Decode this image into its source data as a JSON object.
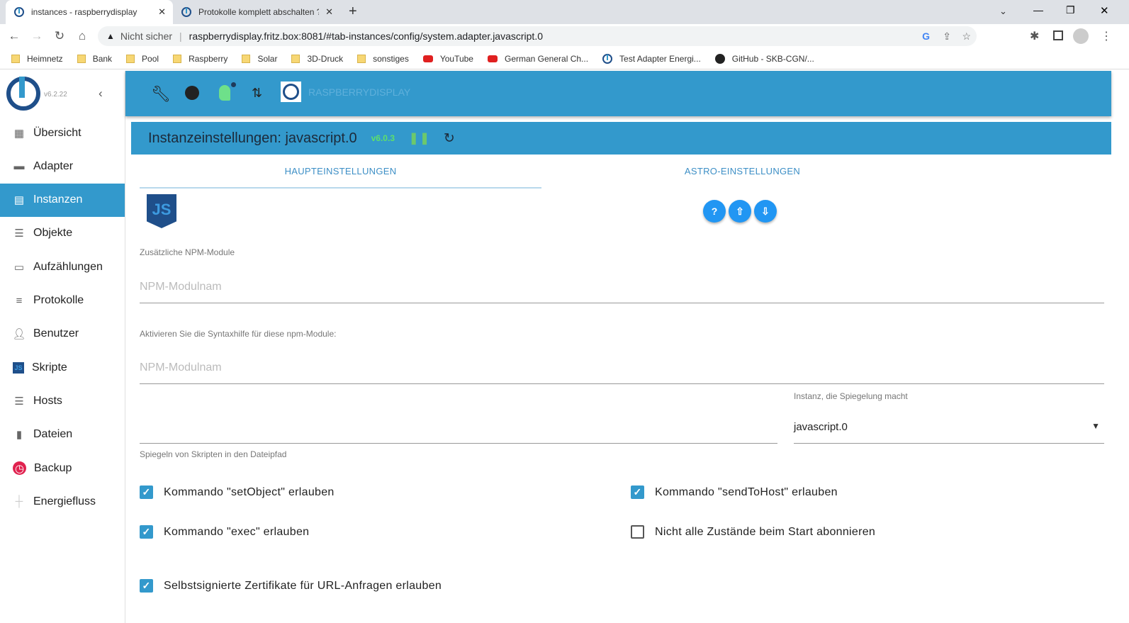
{
  "browser": {
    "tabs": [
      {
        "title": "instances - raspberrydisplay",
        "active": true
      },
      {
        "title": "Protokolle komplett abschalten ?",
        "active": false
      }
    ],
    "security": "Nicht sicher",
    "url": "raspberrydisplay.fritz.box:8081/#tab-instances/config/system.adapter.javascript.0",
    "bookmarks": [
      {
        "label": "Heimnetz",
        "icon": "folder"
      },
      {
        "label": "Bank",
        "icon": "folder"
      },
      {
        "label": "Pool",
        "icon": "folder"
      },
      {
        "label": "Raspberry",
        "icon": "folder"
      },
      {
        "label": "Solar",
        "icon": "folder"
      },
      {
        "label": "3D-Druck",
        "icon": "folder"
      },
      {
        "label": "sonstiges",
        "icon": "folder"
      },
      {
        "label": "YouTube",
        "icon": "youtube"
      },
      {
        "label": "German General Ch...",
        "icon": "youtube"
      },
      {
        "label": "Test Adapter Energi...",
        "icon": "iobroker"
      },
      {
        "label": "GitHub - SKB-CGN/...",
        "icon": "github"
      }
    ]
  },
  "sidebar": {
    "version": "v6.2.22",
    "items": [
      {
        "label": "Übersicht",
        "icon": "grid-icon"
      },
      {
        "label": "Adapter",
        "icon": "store-icon"
      },
      {
        "label": "Instanzen",
        "icon": "instances-icon",
        "active": true
      },
      {
        "label": "Objekte",
        "icon": "list-icon"
      },
      {
        "label": "Aufzählungen",
        "icon": "enum-icon"
      },
      {
        "label": "Protokolle",
        "icon": "log-icon"
      },
      {
        "label": "Benutzer",
        "icon": "user-icon"
      },
      {
        "label": "Skripte",
        "icon": "js-icon"
      },
      {
        "label": "Hosts",
        "icon": "hosts-icon"
      },
      {
        "label": "Dateien",
        "icon": "files-icon"
      },
      {
        "label": "Backup",
        "icon": "backup-icon"
      },
      {
        "label": "Energiefluss",
        "icon": "energy-icon"
      }
    ]
  },
  "topbar": {
    "host": "RASPBERRYDISPLAY"
  },
  "panel": {
    "title": "Instanzeinstellungen: javascript.0",
    "version": "v6.0.3",
    "tabs": [
      {
        "label": "HAUPTEINSTELLUNGEN",
        "active": true
      },
      {
        "label": "ASTRO-EINSTELLUNGEN",
        "active": false
      }
    ],
    "npm_label": "Zusätzliche NPM-Module",
    "npm_placeholder": "NPM-Modulnam",
    "syntax_label": "Aktivieren Sie die Syntaxhilfe für diese npm-Module:",
    "syntax_placeholder": "NPM-Modulnam",
    "mirror_path_label": "Spiegeln von Skripten in den Dateipfad",
    "mirror_instance_label": "Instanz, die Spiegelung macht",
    "mirror_instance_value": "javascript.0",
    "checkboxes": [
      {
        "label": "Kommando \"setObject\" erlauben",
        "checked": true
      },
      {
        "label": "Kommando \"sendToHost\" erlauben",
        "checked": true
      },
      {
        "label": "Kommando \"exec\" erlauben",
        "checked": true
      },
      {
        "label": "Nicht alle Zustände beim Start abonnieren",
        "checked": false
      },
      {
        "label": "Selbstsignierte Zertifikate für URL-Anfragen erlauben",
        "checked": true
      }
    ]
  },
  "colors": {
    "primary": "#3399cc",
    "version": "#5ee06b",
    "fab": "#2196f3",
    "backup": "#e0224f"
  }
}
